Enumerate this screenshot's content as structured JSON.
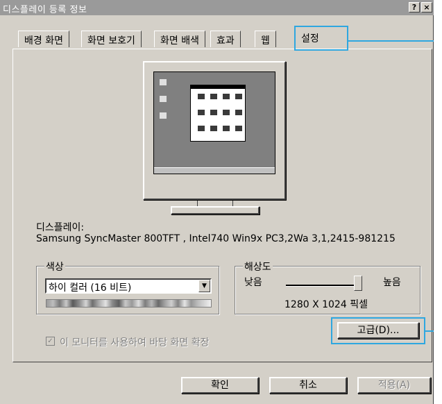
{
  "window": {
    "title": "디스플레이 등록 정보",
    "help_button": "?",
    "close_button": "×"
  },
  "tabs": [
    {
      "label": "배경 화면",
      "active": false
    },
    {
      "label": "화면 보호기",
      "active": false
    },
    {
      "label": "화면 배색",
      "active": false
    },
    {
      "label": "효과",
      "active": false
    },
    {
      "label": "웹",
      "active": false
    },
    {
      "label": "설정",
      "active": true
    }
  ],
  "display": {
    "label": "디스플레이:",
    "monitor_name": "Samsung SyncMaster 800TFT , Intel740 Win9x PC3,2Wa 3,1,2415-981215"
  },
  "color": {
    "group_title": "색상",
    "selected": "하이 컬러 (16 비트)"
  },
  "resolution": {
    "group_title": "해상도",
    "low_label": "낮음",
    "high_label": "높음",
    "value": "1280 X 1024 픽셀",
    "slider_position": 1.0
  },
  "extend_desktop": {
    "label": "이 모니터를 사용하여 바탕 화면 확장",
    "checked": true,
    "enabled": false
  },
  "buttons": {
    "advanced": "고급(D)...",
    "ok": "확인",
    "cancel": "취소",
    "apply": "적용(A)"
  },
  "accent_color": "#2ea7e0"
}
